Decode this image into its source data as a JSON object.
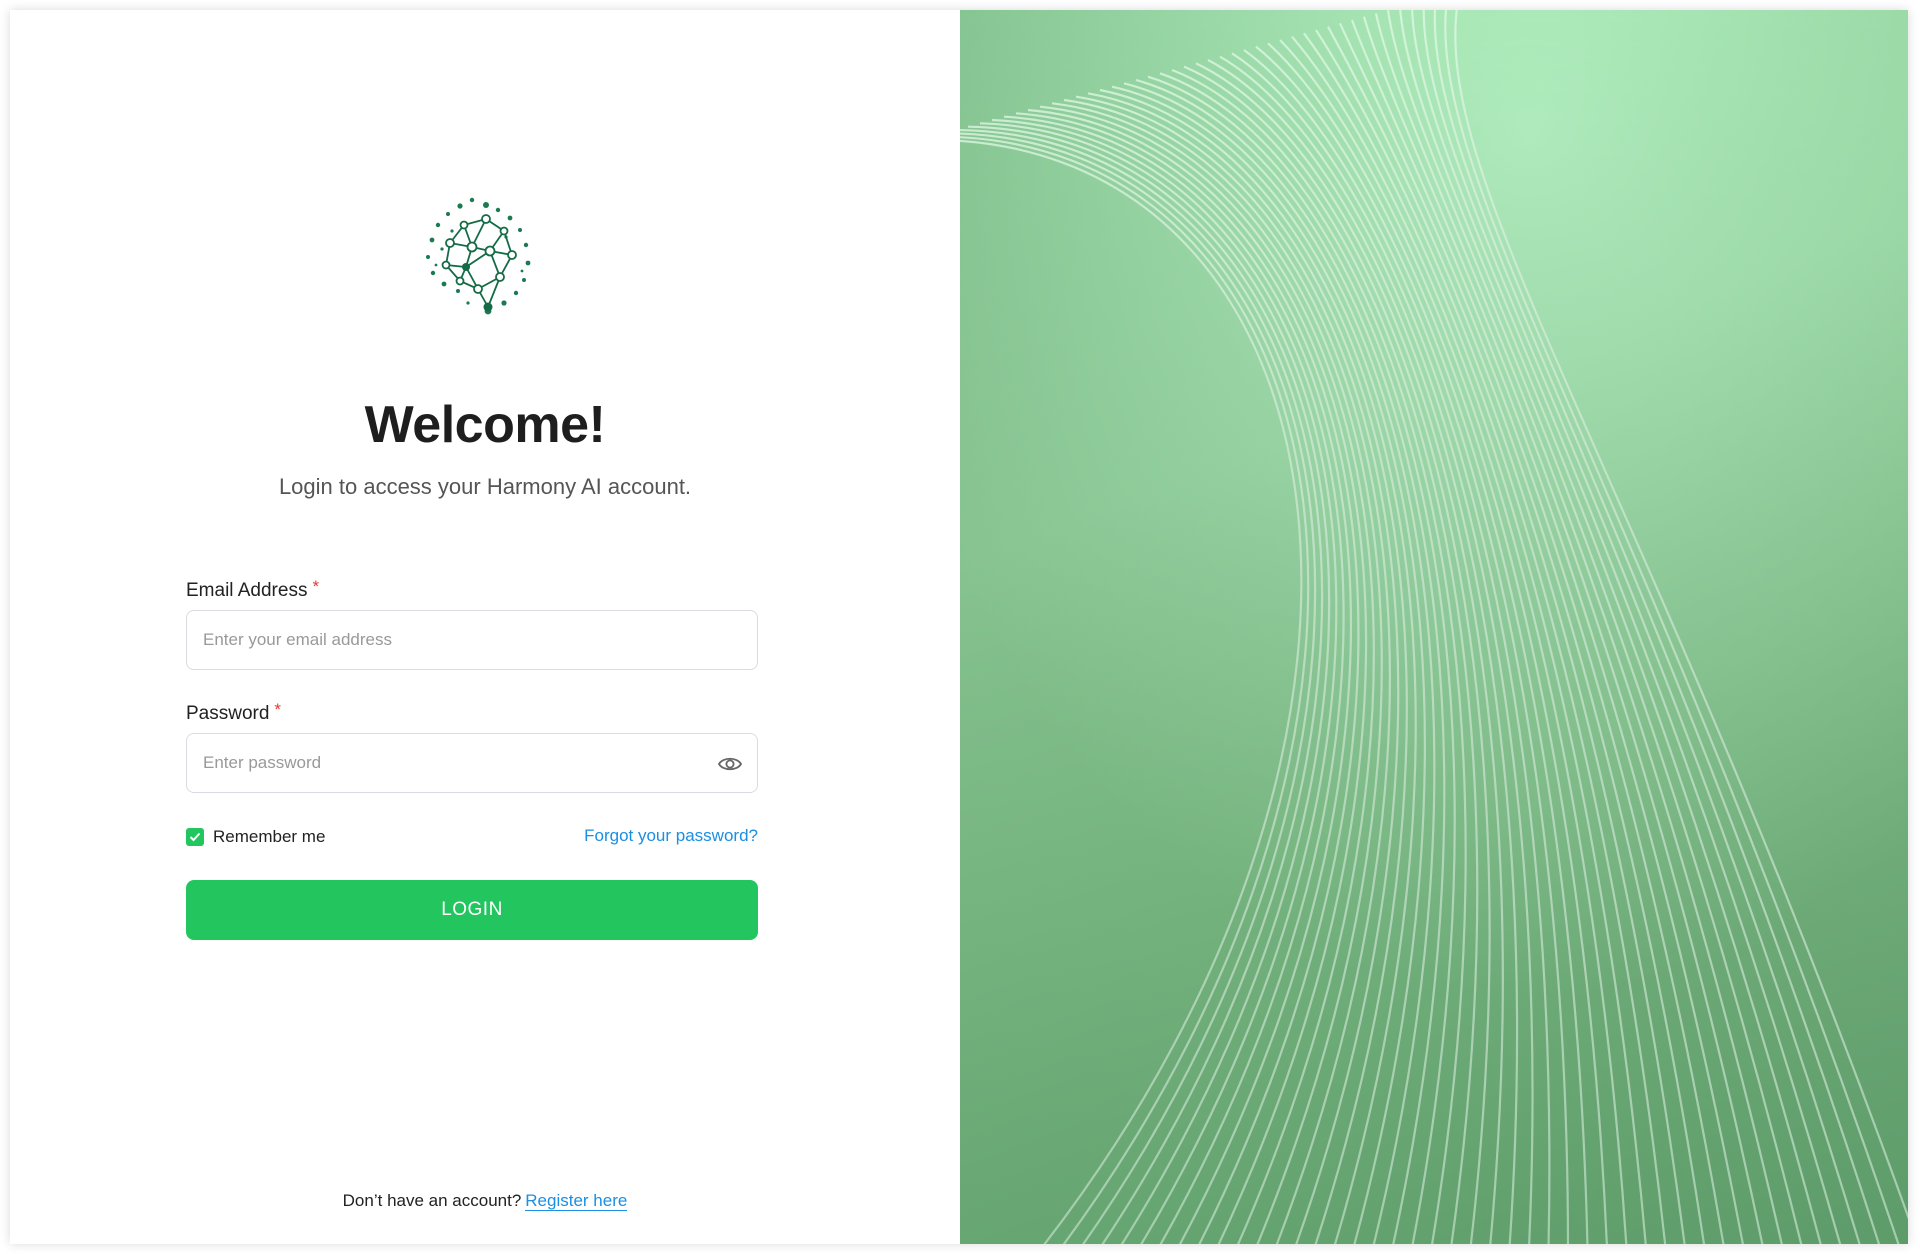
{
  "login": {
    "title": "Welcome!",
    "subtitle": "Login to access your Harmony AI  account.",
    "email_label": "Email Address",
    "email_placeholder": "Enter your email address",
    "email_value": "",
    "password_label": "Password",
    "password_placeholder": "Enter password",
    "password_value": "",
    "required_marker": "*",
    "remember_label": "Remember me",
    "remember_checked": true,
    "forgot_link": "Forgot your password?",
    "login_button": "LOGIN",
    "footer_text": "Don’t have an account?",
    "register_link": "Register here"
  },
  "icons": {
    "logo": "neural-network-brain-logo",
    "password_toggle": "eye-icon",
    "checkbox": "check-icon"
  },
  "colors": {
    "accent": "#22c55e",
    "link": "#1a8fe3",
    "required": "#e53935",
    "logo_dark": "#0f5132",
    "logo_light": "#2aa876",
    "hero_background": "#8fcf9a"
  }
}
